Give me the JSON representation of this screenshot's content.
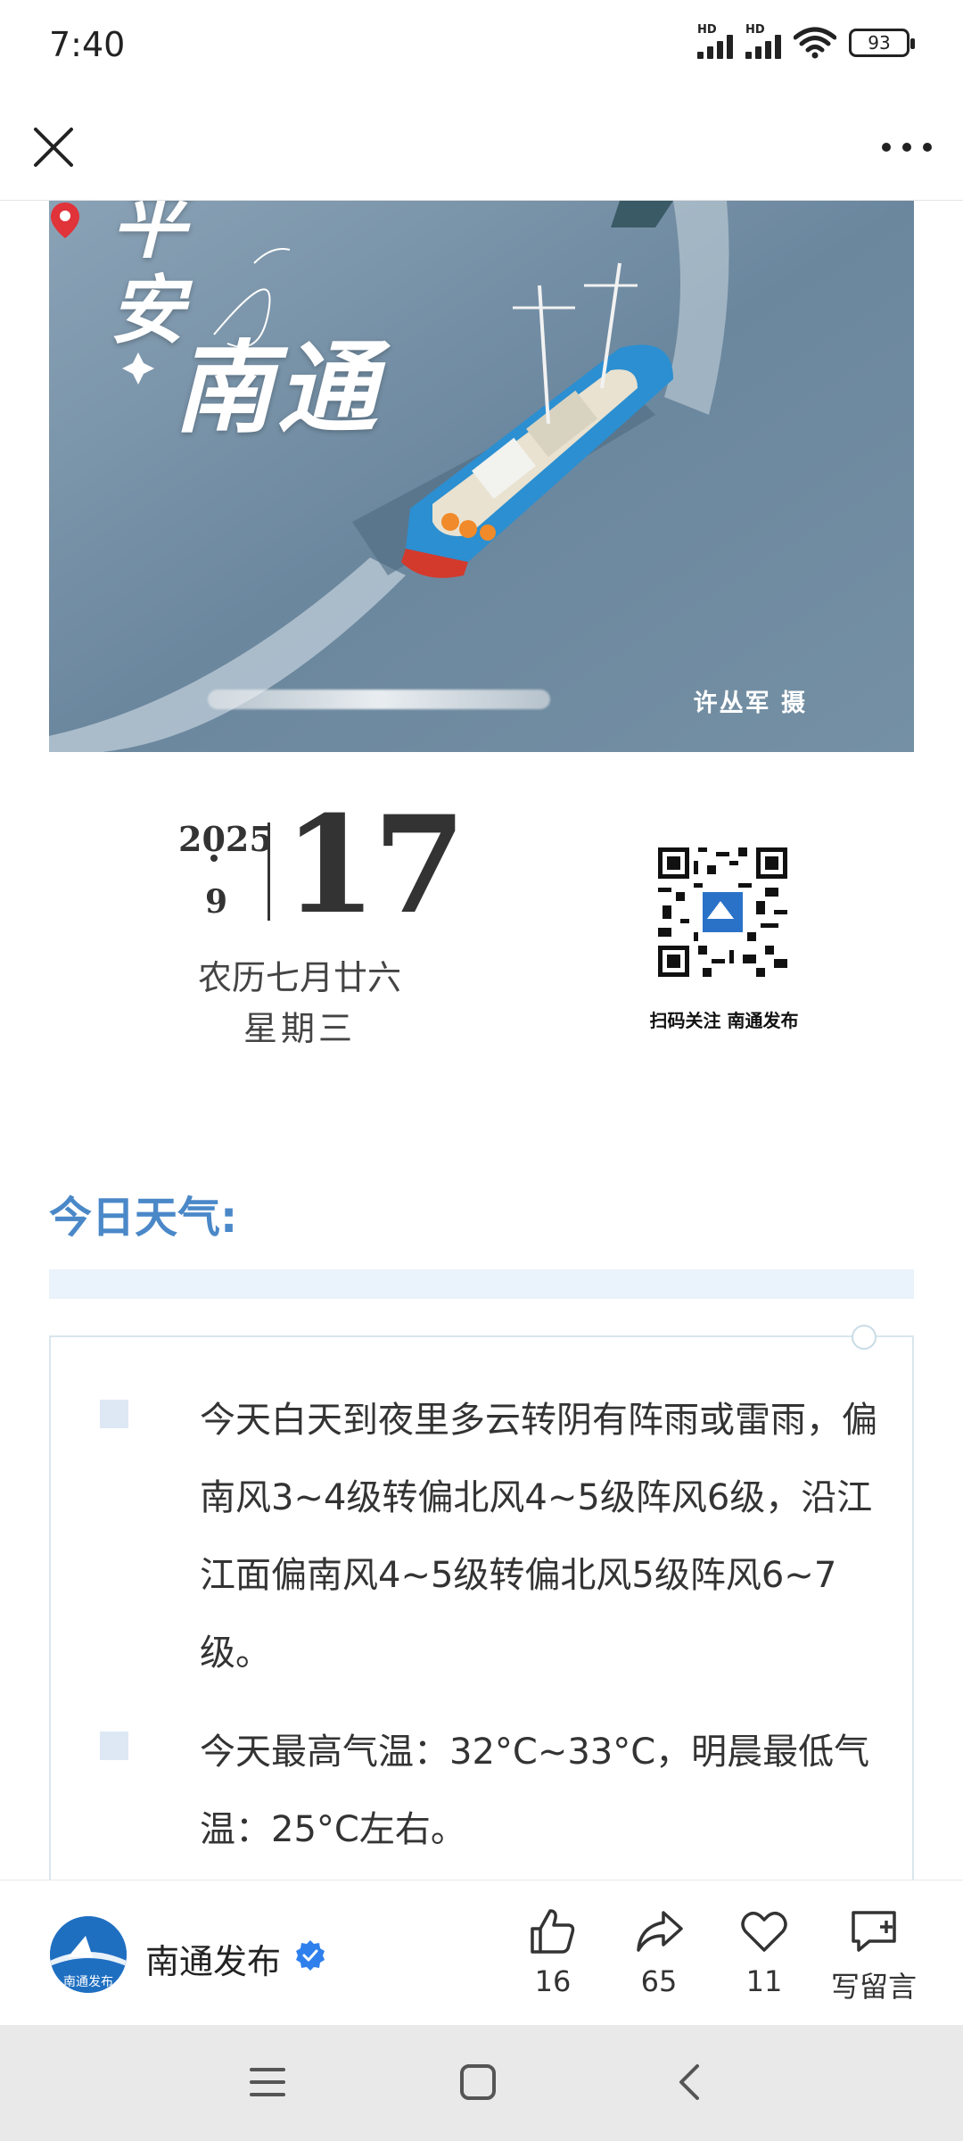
{
  "status_bar": {
    "time": "7:40",
    "network_1": "HD",
    "network_2": "HD",
    "battery": "93"
  },
  "top_nav": {
    "close_icon": "close-icon",
    "more_icon": "more-horizontal-icon"
  },
  "hero": {
    "title_line1": "平",
    "title_line2": "安",
    "title_line3": "南通",
    "photo_credit": "许丛军 摄",
    "location_icon": "location-pin-icon"
  },
  "date": {
    "year": "2025",
    "month": "9",
    "day": "17",
    "lunar": "农历七月廿六",
    "weekday": "星期三"
  },
  "qr": {
    "caption": "扫码关注 南通发布"
  },
  "weather": {
    "heading": "今日天气:",
    "items": [
      "今天白天到夜里多云转阴有阵雨或雷雨，偏南风3~4级转偏北风4~5级阵风6级，沿江江面偏南风4~5级转偏北风5级阵风6~7级。",
      "今天最高气温：32°C~33°C，明晨最低气温：25°C左右。"
    ]
  },
  "action_bar": {
    "account_name": "南通发布",
    "avatar_text": "南通发布",
    "like_count": "16",
    "share_count": "65",
    "favorite_count": "11",
    "comment_label": "写留言"
  },
  "colors": {
    "accent_blue": "#4a88c8",
    "band_blue": "#eaf2fb",
    "verified_blue": "#2f80ed"
  }
}
